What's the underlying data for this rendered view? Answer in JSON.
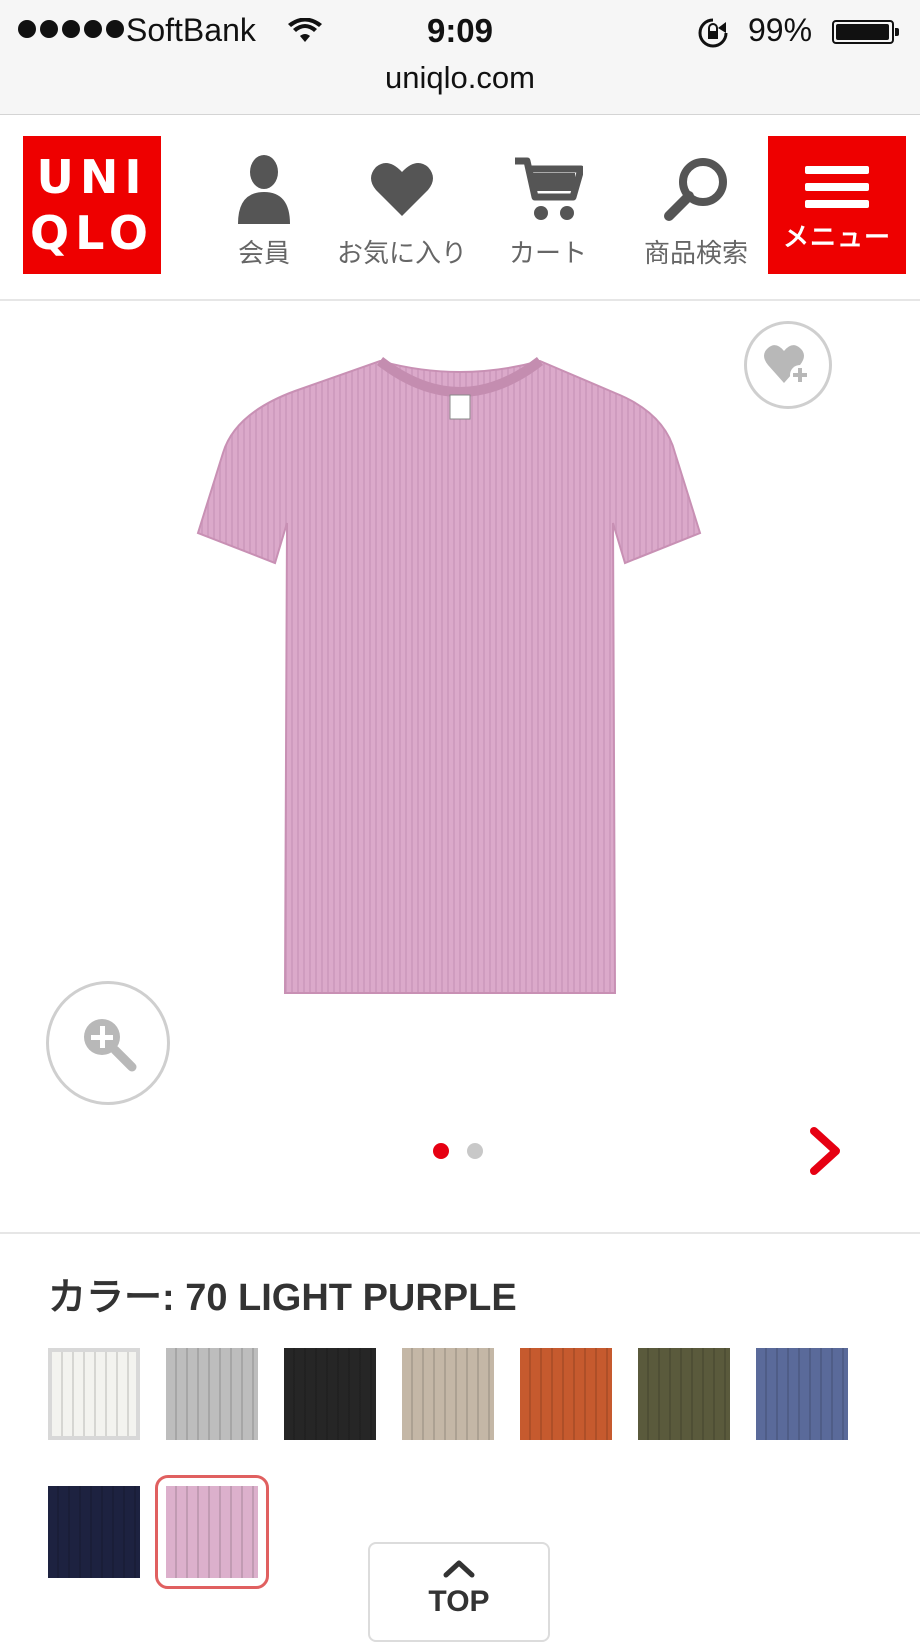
{
  "status_bar": {
    "carrier": "SoftBank",
    "time": "9:09",
    "battery": "99%",
    "battery_level": 0.99
  },
  "browser": {
    "url": "uniqlo.com"
  },
  "header": {
    "logo_line1": "UNI",
    "logo_line2": "QLO",
    "brand_color": "#ee0000",
    "nav": {
      "member": "会員",
      "favorites": "お気に入り",
      "cart": "カート",
      "search": "商品検索"
    },
    "menu_label": "メニュー"
  },
  "gallery": {
    "image_count": 2,
    "active_index": 0,
    "product_color": "#d9a9c9"
  },
  "color_section": {
    "title": "カラー: 70 LIGHT PURPLE",
    "swatches": [
      {
        "color": "#f3f3ef"
      },
      {
        "color": "#bdbdbd"
      },
      {
        "color": "#262626"
      },
      {
        "color": "#c4b7a6"
      },
      {
        "color": "#c65a2e"
      },
      {
        "color": "#5a5a3c"
      },
      {
        "color": "#5a6a9a"
      },
      {
        "color": "#1d2240"
      },
      {
        "color": "#dcb0cc",
        "selected": true
      }
    ]
  },
  "top_button": {
    "label": "TOP"
  }
}
